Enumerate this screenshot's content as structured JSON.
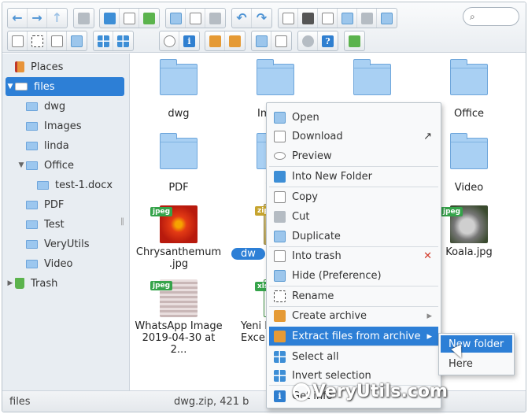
{
  "toolbar": {
    "search_placeholder": ""
  },
  "sidebar": {
    "places": "Places",
    "root": "files",
    "items": [
      {
        "label": "dwg"
      },
      {
        "label": "Images"
      },
      {
        "label": "linda"
      },
      {
        "label": "Office"
      },
      {
        "label": "test-1.docx"
      },
      {
        "label": "PDF"
      },
      {
        "label": "Test"
      },
      {
        "label": "VeryUtils"
      },
      {
        "label": "Video"
      }
    ],
    "trash": "Trash"
  },
  "main": {
    "row1": [
      "dwg",
      "Im",
      "",
      "Office"
    ],
    "row2": [
      "PDF",
      "T",
      "",
      "Video"
    ],
    "row3": [
      {
        "name": "Chrysanthemum .jpg",
        "line1": "Chrysanthemum",
        "line2": ".jpg",
        "tag": "jpeg"
      },
      {
        "name": "dw",
        "tag": "zip"
      },
      {
        "name": "Koala.jpg",
        "tag": "jpeg"
      }
    ],
    "row4": [
      {
        "line1": "WhatsApp Image",
        "line2": "2019-04-30 at 2...",
        "tag": "jpeg"
      },
      {
        "line1": "Yeni N",
        "line2": "Excel",
        "tag": "xlsx"
      }
    ]
  },
  "context_menu": {
    "items": [
      {
        "label": "Open",
        "icon": "open-icon"
      },
      {
        "label": "Download",
        "icon": "download-icon",
        "right": "↗"
      },
      {
        "label": "Preview",
        "icon": "eye-icon"
      },
      {
        "label": "Into New Folder",
        "icon": "new-folder-icon"
      },
      {
        "label": "Copy",
        "icon": "copy-icon"
      },
      {
        "label": "Cut",
        "icon": "scissors-icon"
      },
      {
        "label": "Duplicate",
        "icon": "duplicate-icon"
      },
      {
        "label": "Into trash",
        "icon": "trash-icon",
        "right": "✕"
      },
      {
        "label": "Hide (Preference)",
        "icon": "hide-icon"
      },
      {
        "label": "Rename",
        "icon": "rename-icon"
      },
      {
        "label": "Create archive",
        "icon": "archive-icon"
      },
      {
        "label": "Extract files from archive",
        "icon": "extract-icon",
        "right": "▸"
      },
      {
        "label": "Select all",
        "icon": "select-all-icon"
      },
      {
        "label": "Invert selection",
        "icon": "invert-icon"
      },
      {
        "label": "Get info",
        "icon": "info-icon"
      }
    ],
    "submenu": [
      "New folder",
      "Here"
    ]
  },
  "status": {
    "left": "files",
    "middle": "dwg.zip, 421 b"
  },
  "watermark": "VeryUtils.com",
  "colors": {
    "accent": "#2d7fd6",
    "sidebar_bg": "#e8edf2",
    "folder": "#a9d0f3"
  }
}
